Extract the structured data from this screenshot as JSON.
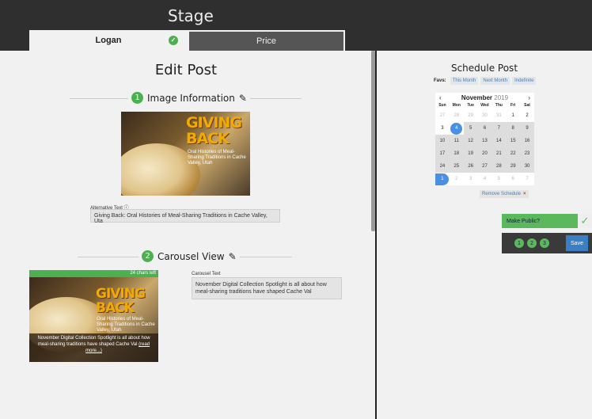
{
  "header": {
    "title": "Stage"
  },
  "tabs": [
    {
      "label": "Logan",
      "status": "complete"
    },
    {
      "label": "Price"
    }
  ],
  "edit": {
    "title": "Edit Post",
    "section1": {
      "number": "1",
      "title": "Image Information"
    },
    "hero": {
      "headline": "GIVING BACK",
      "sub": "Oral Histories of Meal-Sharing Traditions in Cache Valley, Utah"
    },
    "alt_label": "Alternative Text",
    "alt_value": "Giving Back: Oral Histories of Meal-Sharing Traditions in Cache Valley, Uta",
    "section2": {
      "number": "2",
      "title": "Carousel View"
    },
    "chars_left": "24 chars left",
    "carousel_caption": "November Digital Collection Spotlight is all about how meal-sharing traditions have shaped Cache Val",
    "read_more": "(read more...)",
    "carousel_label": "Carousel Text",
    "carousel_value": "November Digital Collection Spotlight is all about how meal-sharing traditions have shaped Cache Val"
  },
  "schedule": {
    "title": "Schedule Post",
    "favs_label": "Favs:",
    "favs": [
      "This Month",
      "Next Month",
      "Indefinite"
    ],
    "month": "November",
    "year": "2019",
    "prev": "‹",
    "next": "›",
    "dow": [
      "Sun",
      "Mon",
      "Tue",
      "Wed",
      "Thu",
      "Fri",
      "Sat"
    ],
    "days": [
      {
        "d": "27",
        "t": "out"
      },
      {
        "d": "28",
        "t": "out"
      },
      {
        "d": "29",
        "t": "out"
      },
      {
        "d": "30",
        "t": "out"
      },
      {
        "d": "31",
        "t": "out"
      },
      {
        "d": "1",
        "t": "wkd"
      },
      {
        "d": "2",
        "t": "wkd"
      },
      {
        "d": "3",
        "t": "wkd"
      },
      {
        "d": "4",
        "t": "sel"
      },
      {
        "d": "5",
        "t": "dis"
      },
      {
        "d": "6",
        "t": "dis"
      },
      {
        "d": "7",
        "t": "dis"
      },
      {
        "d": "8",
        "t": "dis"
      },
      {
        "d": "9",
        "t": "dis"
      },
      {
        "d": "10",
        "t": "dis"
      },
      {
        "d": "11",
        "t": "dis"
      },
      {
        "d": "12",
        "t": "dis"
      },
      {
        "d": "13",
        "t": "dis"
      },
      {
        "d": "14",
        "t": "dis"
      },
      {
        "d": "15",
        "t": "dis"
      },
      {
        "d": "16",
        "t": "dis"
      },
      {
        "d": "17",
        "t": "dis"
      },
      {
        "d": "18",
        "t": "dis"
      },
      {
        "d": "19",
        "t": "dis"
      },
      {
        "d": "20",
        "t": "dis"
      },
      {
        "d": "21",
        "t": "dis"
      },
      {
        "d": "22",
        "t": "dis"
      },
      {
        "d": "23",
        "t": "dis"
      },
      {
        "d": "24",
        "t": "dis"
      },
      {
        "d": "25",
        "t": "dis"
      },
      {
        "d": "26",
        "t": "dis"
      },
      {
        "d": "27",
        "t": "dis"
      },
      {
        "d": "28",
        "t": "dis"
      },
      {
        "d": "29",
        "t": "dis"
      },
      {
        "d": "30",
        "t": "dis"
      },
      {
        "d": "1",
        "t": "pick"
      },
      {
        "d": "2",
        "t": "out"
      },
      {
        "d": "3",
        "t": "out"
      },
      {
        "d": "4",
        "t": "out"
      },
      {
        "d": "5",
        "t": "out"
      },
      {
        "d": "6",
        "t": "out"
      },
      {
        "d": "7",
        "t": "out"
      }
    ],
    "remove_label": "Remove Schedule",
    "remove_icon": "×"
  },
  "publish": {
    "make_public": "Make Public?",
    "check": "✓",
    "steps": [
      "1",
      "2",
      "3"
    ],
    "save": "Save"
  },
  "colors": {
    "accent_green": "#4caf50",
    "accent_blue": "#4a90e2",
    "dark": "#2f2f2f"
  }
}
